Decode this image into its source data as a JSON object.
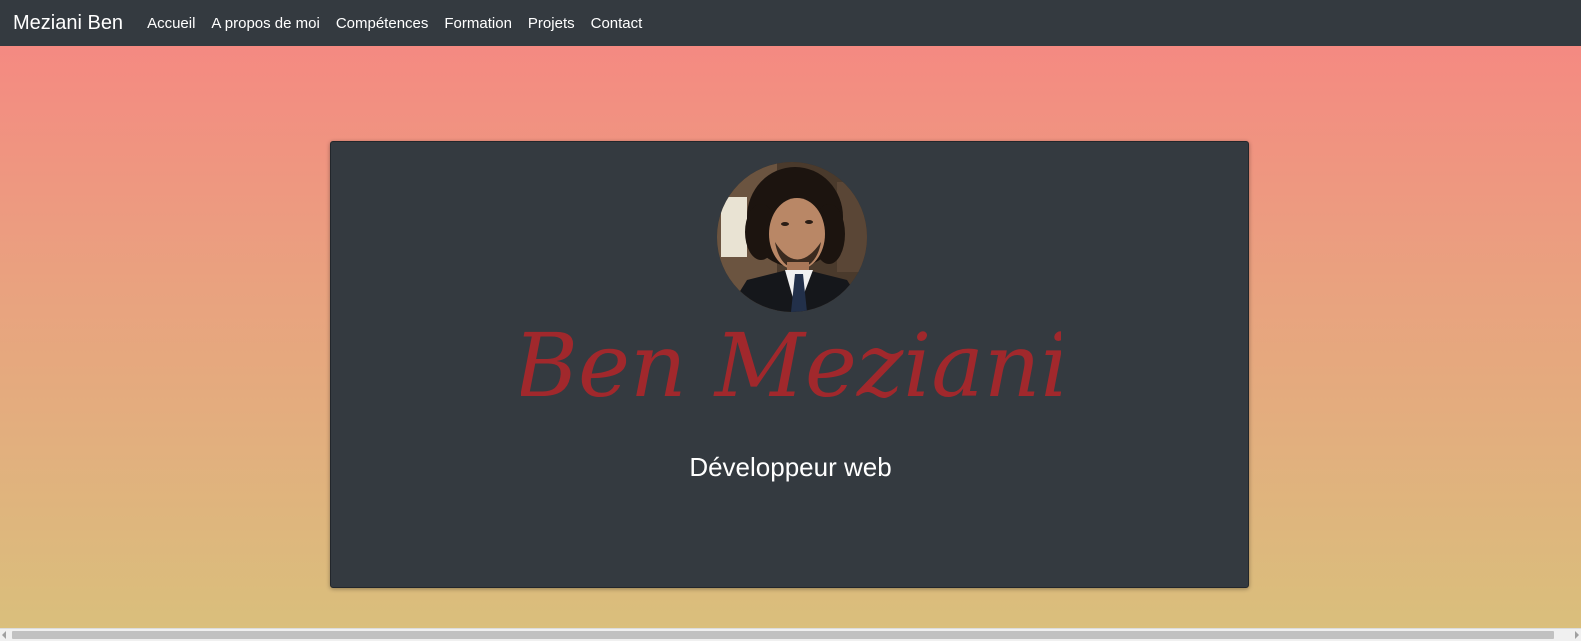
{
  "navbar": {
    "brand": "Meziani Ben",
    "links": [
      {
        "label": "Accueil"
      },
      {
        "label": "A propos de moi"
      },
      {
        "label": "Compétences"
      },
      {
        "label": "Formation"
      },
      {
        "label": "Projets"
      },
      {
        "label": "Contact"
      }
    ]
  },
  "hero": {
    "name": "Ben Meziani",
    "subtitle": "Développeur web",
    "name_color": "#a1282c",
    "card_color": "#343a40",
    "avatar_icon": "profile-photo"
  },
  "colors": {
    "gradient_top": "#f78582",
    "gradient_bottom": "#d9c07c",
    "navbar": "#343a40"
  }
}
